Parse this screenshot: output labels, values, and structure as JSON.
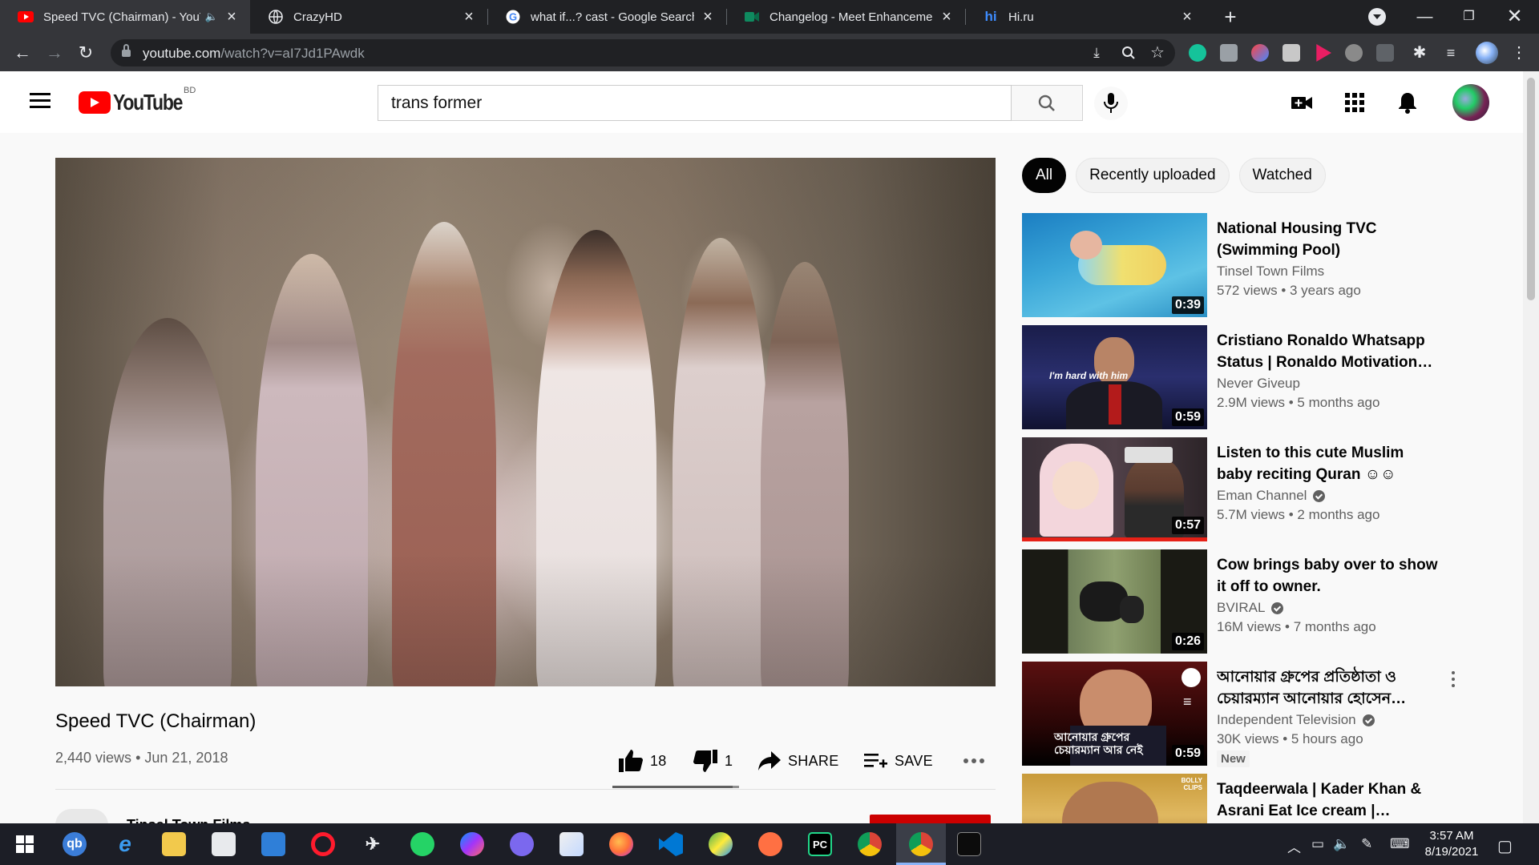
{
  "browser": {
    "tabs": [
      {
        "title": "Speed TVC (Chairman) - YouTube",
        "favicon": "youtube-favicon",
        "audio": true,
        "active": true
      },
      {
        "title": "CrazyHD",
        "favicon": "globe-favicon"
      },
      {
        "title": "what if...? cast - Google Search",
        "favicon": "google-favicon"
      },
      {
        "title": "Changelog - Meet Enhancement Suite",
        "favicon": "meet-favicon"
      },
      {
        "title": "Hi.ru",
        "favicon": "hi-favicon"
      }
    ],
    "url_host": "youtube.com",
    "url_path": "/watch?v=aI7Jd1PAwdk"
  },
  "youtube": {
    "logo_text": "YouTube",
    "country_code": "BD",
    "search_value": "trans former",
    "video": {
      "title": "Speed TVC (Chairman)",
      "views": "2,440 views",
      "date": "Jun 21, 2018",
      "likes": "18",
      "dislikes": "1",
      "like_ratio": 0.947,
      "share_label": "SHARE",
      "save_label": "SAVE",
      "channel": "Tinsel Town Films"
    },
    "chips": [
      "All",
      "Recently uploaded",
      "Watched"
    ],
    "recommendations": [
      {
        "title": "National Housing TVC (Swimming Pool)",
        "channel": "Tinsel Town Films",
        "verified": false,
        "stats": "572 views • 3 years ago",
        "duration": "0:39"
      },
      {
        "title": "Cristiano Ronaldo Whatsapp Status | Ronaldo Motivation…",
        "channel": "Never Giveup",
        "verified": false,
        "stats": "2.9M views • 5 months ago",
        "duration": "0:59",
        "thumb_caption": "I'm hard with him"
      },
      {
        "title": "Listen to this cute Muslim baby reciting Quran ☺☺",
        "channel": "Eman Channel",
        "verified": true,
        "stats": "5.7M views • 2 months ago",
        "duration": "0:57",
        "progress": 1.0
      },
      {
        "title": "Cow brings baby over to show it off to owner.",
        "channel": "BVIRAL",
        "verified": true,
        "stats": "16M views • 7 months ago",
        "duration": "0:26"
      },
      {
        "title": "আনোয়ার গ্রুপের প্রতিষ্ঠাতা ও চেয়ারম্যান আনোয়ার হোসেন…",
        "channel": "Independent Television",
        "verified": true,
        "stats": "30K views • 5 hours ago",
        "duration": "0:59",
        "badge": "New",
        "thumb_caption": "আনোয়ার গ্রুপের চেয়ারম্যান আর নেই"
      },
      {
        "title": "Taqdeerwala | Kader Khan & Asrani Eat Ice cream |…",
        "channel": "",
        "verified": false,
        "stats": "",
        "duration": "",
        "thumb_caption": "BOLLY CLIPS"
      }
    ]
  },
  "taskbar": {
    "clock_time": "3:57 AM",
    "clock_date": "8/19/2021"
  },
  "colors": {
    "youtube_red": "#ff0000",
    "chrome_dark": "#202124",
    "chrome_tab_active": "#35363a",
    "taskbar": "#1c1e26"
  }
}
